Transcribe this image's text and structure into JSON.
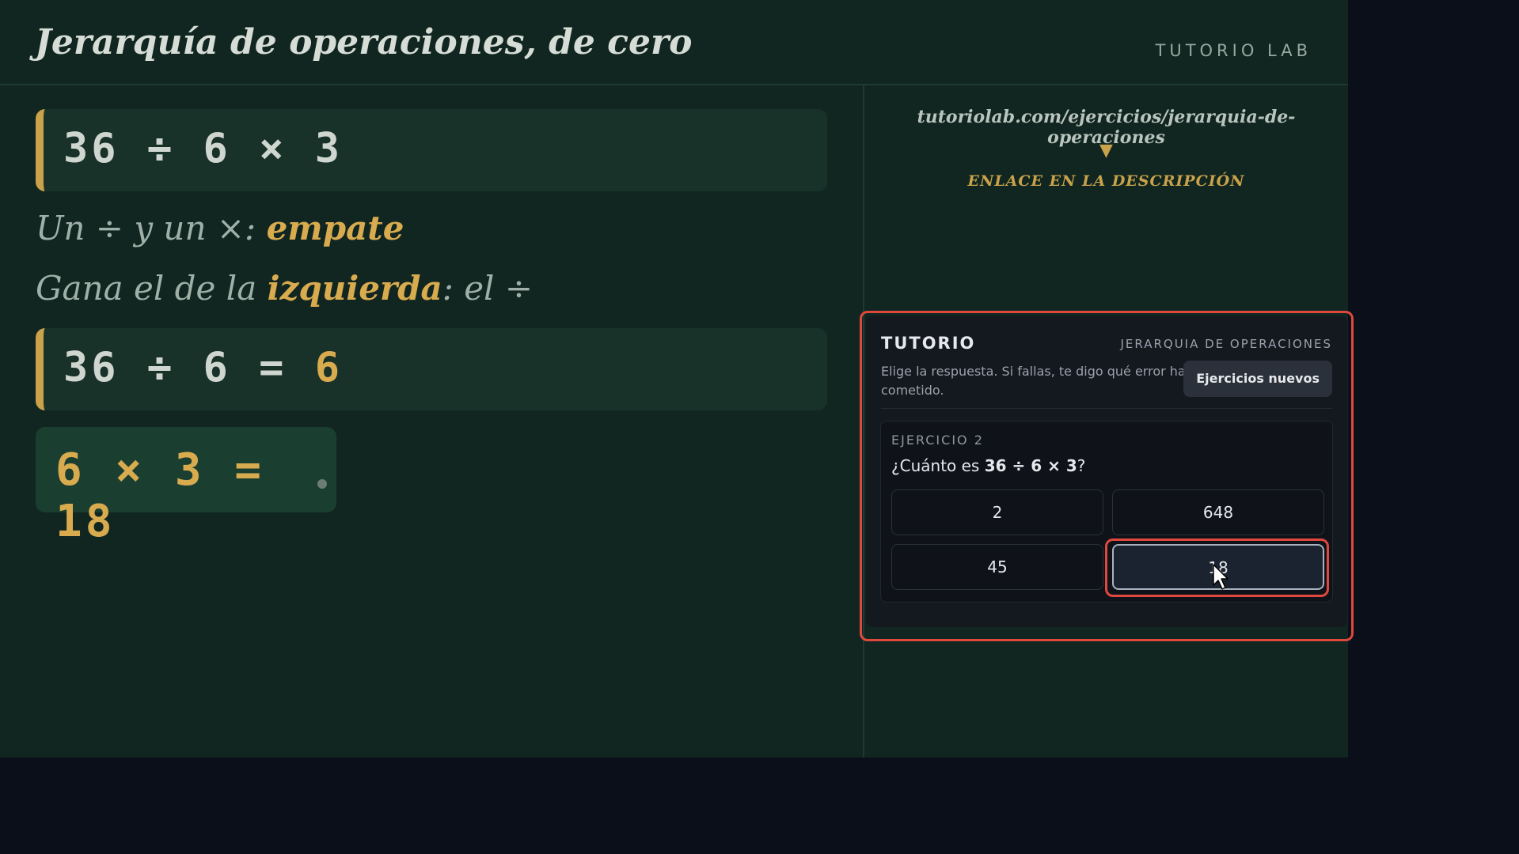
{
  "header": {
    "title": "Jerarquía de operaciones, de cero",
    "brand": "TUTORIO LAB"
  },
  "board": {
    "expression": "36 ÷ 6 × 3",
    "note1_prefix": "Un ÷ y un ×: ",
    "note1_highlight": "empate",
    "note2_prefix": "Gana el de la ",
    "note2_highlight": "izquierda",
    "note2_suffix": ": el ÷",
    "step1_left": "36 ÷ 6 = ",
    "step1_result": "6",
    "step2": "6 × 3 = 18"
  },
  "sidebar": {
    "url": "tutoriolab.com/ejercicios/jerarquia-de-operaciones",
    "arrow": "▼",
    "link_caption": "ENLACE EN LA DESCRIPCIÓN"
  },
  "widget": {
    "brand": "TUTORIO",
    "topic": "JERARQUIA DE OPERACIONES",
    "instructions": "Elige la respuesta. Si fallas, te digo qué error has cometido.",
    "new_exercises_label": "Ejercicios nuevos",
    "exercise": {
      "label": "EJERCICIO 2",
      "question_prefix": "¿Cuánto es ",
      "question_expr": "36 ÷ 6 × 3",
      "question_suffix": "?",
      "options": [
        "2",
        "648",
        "45",
        "18"
      ],
      "selected_option": "18"
    }
  },
  "colors": {
    "board_bg": "#112620",
    "accent": "#d9ab4f",
    "highlight_outline": "#e0483d"
  },
  "icons": {
    "cursor": "mouse-pointer-icon"
  }
}
